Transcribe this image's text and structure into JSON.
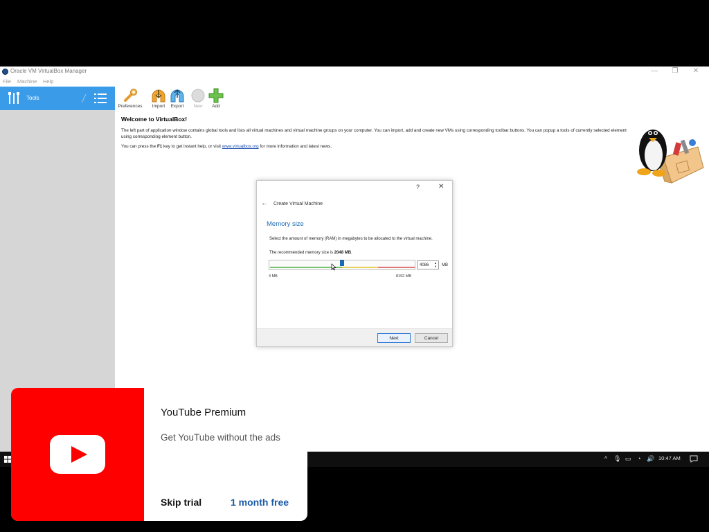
{
  "window": {
    "title": "Oracle VM VirtualBox Manager",
    "controls": {
      "minimize": "—",
      "restore": "❐",
      "close": "✕"
    },
    "menu": [
      "File",
      "Machine",
      "Help"
    ]
  },
  "sidebar": {
    "tools_label": "Tools"
  },
  "toolbar": {
    "items": [
      {
        "label": "Preferences",
        "icon": "preferences-icon",
        "enabled": true
      },
      {
        "label": "Import",
        "icon": "import-icon",
        "enabled": true
      },
      {
        "label": "Export",
        "icon": "export-icon",
        "enabled": true
      },
      {
        "label": "New",
        "icon": "new-icon",
        "enabled": false
      },
      {
        "label": "Add",
        "icon": "add-icon",
        "enabled": true
      }
    ]
  },
  "welcome": {
    "heading": "Welcome to VirtualBox!",
    "para1": "The left part of application window contains global tools and lists all virtual machines and virtual machine groups on your computer. You can import, add and create new VMs using corresponding toolbar buttons. You can popup a tools of currently selected element using corresponding element button.",
    "para2_before": "You can press the ",
    "para2_key": "F1",
    "para2_mid": " key to get instant help, or visit ",
    "para2_link": "www.virtualbox.org",
    "para2_after": " for more information and latest news."
  },
  "dialog": {
    "help": "?",
    "close": "✕",
    "title": "Create Virtual Machine",
    "section": "Memory size",
    "description": "Select the amount of memory (RAM) in megabytes to be allocated to the virtual machine.",
    "recommended_before": "The recommended memory size is ",
    "recommended_value": "2048 MB",
    "recommended_after": ".",
    "memory_value": "4086",
    "unit": "MB",
    "min_label": "4 MB",
    "max_label": "8192 MB",
    "slider_fraction": 0.5,
    "next_label": "Next",
    "cancel_label": "Cancel"
  },
  "taskbar": {
    "clock": "10:47 AM"
  },
  "promo": {
    "title": "YouTube Premium",
    "subtitle": "Get YouTube without the ads",
    "skip_label": "Skip trial",
    "offer_label": "1 month free",
    "brand_color": "#ff0000",
    "link_color": "#1a5aa8"
  }
}
